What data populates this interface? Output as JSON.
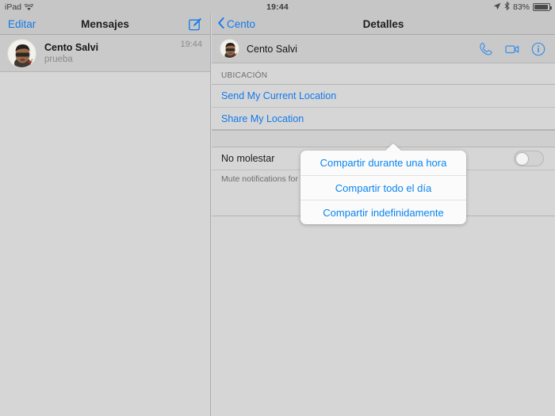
{
  "status_bar": {
    "device": "iPad",
    "wifi_icon": "wifi-icon",
    "time": "19:44",
    "location_icon": "location-arrow-icon",
    "bluetooth_icon": "bluetooth-icon",
    "battery_percent": "83%",
    "battery_icon": "battery-icon"
  },
  "left_pane": {
    "nav": {
      "edit_label": "Editar",
      "title": "Mensajes",
      "compose_icon": "compose-icon"
    },
    "conversations": [
      {
        "name": "Cento Salvi",
        "preview": "prueba",
        "time": "19:44",
        "avatar": "contact-avatar"
      }
    ]
  },
  "right_pane": {
    "nav": {
      "back_label": "Cento",
      "back_icon": "chevron-left-icon",
      "title": "Detalles"
    },
    "contact": {
      "name": "Cento Salvi",
      "avatar": "contact-avatar",
      "actions": [
        {
          "name": "phone-icon",
          "label": "phone"
        },
        {
          "name": "facetime-video-icon",
          "label": "video"
        },
        {
          "name": "info-icon",
          "label": "info"
        }
      ]
    },
    "location_section": {
      "header": "UBICACIÓN",
      "items": [
        {
          "label": "Send My Current Location"
        },
        {
          "label": "Share My Location"
        }
      ]
    },
    "do_not_disturb": {
      "label": "No molestar",
      "toggle_state": "off",
      "footnote": "Mute notifications for this conversation."
    }
  },
  "popover": {
    "options": [
      {
        "label": "Compartir durante una hora"
      },
      {
        "label": "Compartir todo el día"
      },
      {
        "label": "Compartir indefinidamente"
      }
    ]
  },
  "colors": {
    "accent_blue": "#1279ec",
    "popover_blue": "#0a84f0",
    "chrome_gray": "#c6c6c6",
    "body_gray": "#d6d6d6"
  }
}
